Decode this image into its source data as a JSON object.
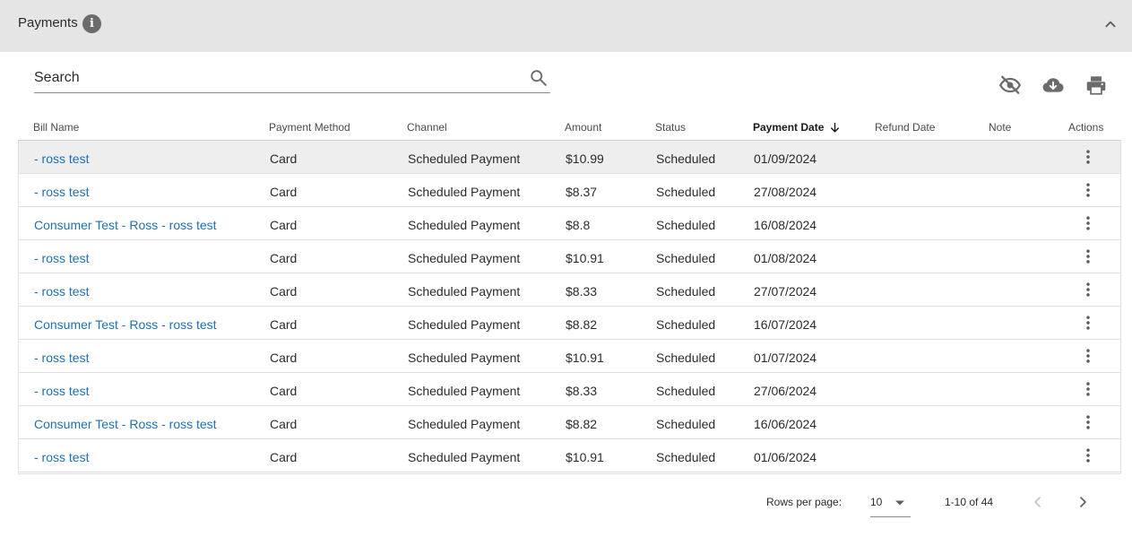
{
  "panel": {
    "title": "Payments",
    "info_icon": "info-icon",
    "collapse_icon": "chevron-up-icon"
  },
  "search": {
    "placeholder": "Search",
    "icon": "search-icon"
  },
  "toolbar": {
    "icons": [
      "visibility-off-icon",
      "cloud-download-icon",
      "print-icon"
    ]
  },
  "table": {
    "columns": [
      "Bill Name",
      "Payment Method",
      "Channel",
      "Amount",
      "Status",
      "Payment Date",
      "Refund Date",
      "Note",
      "Actions"
    ],
    "sorted_column": "Payment Date",
    "sort_direction": "descending",
    "rows": [
      {
        "bill_name": "- ross test",
        "method": "Card",
        "channel": "Scheduled Payment",
        "amount": "$10.99",
        "status": "Scheduled",
        "payment_date": "01/09/2024",
        "refund_date": "",
        "note": ""
      },
      {
        "bill_name": "- ross test",
        "method": "Card",
        "channel": "Scheduled Payment",
        "amount": "$8.37",
        "status": "Scheduled",
        "payment_date": "27/08/2024",
        "refund_date": "",
        "note": ""
      },
      {
        "bill_name": "Consumer Test - Ross - ross test",
        "method": "Card",
        "channel": "Scheduled Payment",
        "amount": "$8.8",
        "status": "Scheduled",
        "payment_date": "16/08/2024",
        "refund_date": "",
        "note": ""
      },
      {
        "bill_name": "- ross test",
        "method": "Card",
        "channel": "Scheduled Payment",
        "amount": "$10.91",
        "status": "Scheduled",
        "payment_date": "01/08/2024",
        "refund_date": "",
        "note": ""
      },
      {
        "bill_name": "- ross test",
        "method": "Card",
        "channel": "Scheduled Payment",
        "amount": "$8.33",
        "status": "Scheduled",
        "payment_date": "27/07/2024",
        "refund_date": "",
        "note": ""
      },
      {
        "bill_name": "Consumer Test - Ross - ross test",
        "method": "Card",
        "channel": "Scheduled Payment",
        "amount": "$8.82",
        "status": "Scheduled",
        "payment_date": "16/07/2024",
        "refund_date": "",
        "note": ""
      },
      {
        "bill_name": "- ross test",
        "method": "Card",
        "channel": "Scheduled Payment",
        "amount": "$10.91",
        "status": "Scheduled",
        "payment_date": "01/07/2024",
        "refund_date": "",
        "note": ""
      },
      {
        "bill_name": "- ross test",
        "method": "Card",
        "channel": "Scheduled Payment",
        "amount": "$8.33",
        "status": "Scheduled",
        "payment_date": "27/06/2024",
        "refund_date": "",
        "note": ""
      },
      {
        "bill_name": "Consumer Test - Ross - ross test",
        "method": "Card",
        "channel": "Scheduled Payment",
        "amount": "$8.82",
        "status": "Scheduled",
        "payment_date": "16/06/2024",
        "refund_date": "",
        "note": ""
      },
      {
        "bill_name": "- ross test",
        "method": "Card",
        "channel": "Scheduled Payment",
        "amount": "$10.91",
        "status": "Scheduled",
        "payment_date": "01/06/2024",
        "refund_date": "",
        "note": ""
      }
    ],
    "row_action_icon": "more-vertical-icon"
  },
  "pagination": {
    "rows_per_page_label": "Rows per page:",
    "rows_per_page_value": "10",
    "range_label": "1-10 of 44",
    "prev_icon": "chevron-left-icon",
    "next_icon": "chevron-right-icon"
  },
  "colors": {
    "header_bg": "#e5e5e5",
    "link": "#1f6fb5",
    "row_highlight": "#eeeeee",
    "icon": "#6b6b6b"
  }
}
